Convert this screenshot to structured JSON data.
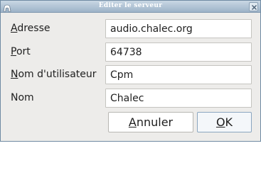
{
  "window": {
    "title": "Editer le serveur"
  },
  "fields": [
    {
      "mnemonic": "A",
      "label_rest": "dresse",
      "value": "audio.chalec.org"
    },
    {
      "mnemonic": "P",
      "label_rest": "ort",
      "value": "64738"
    },
    {
      "mnemonic": "N",
      "label_rest": "om d'utilisateur",
      "value": "Cpm"
    },
    {
      "mnemonic": "",
      "label_rest": "Nom",
      "value": "Chalec"
    }
  ],
  "buttons": {
    "cancel_mnemonic": "A",
    "cancel_rest": "nnuler",
    "ok_mnemonic": "O",
    "ok_rest": "K"
  },
  "colors": {
    "titlebar": "#9db3c8",
    "dialog_bg": "#edecea",
    "field_bg": "#ffffff"
  },
  "icons": {
    "app": "app-icon",
    "close": "close-icon"
  }
}
